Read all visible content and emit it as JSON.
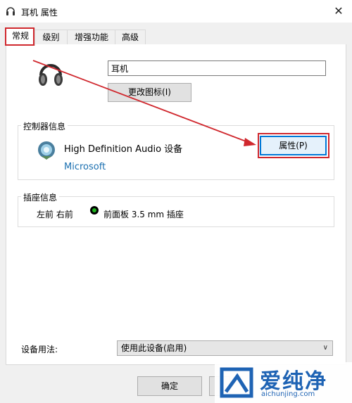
{
  "window": {
    "title": "耳机 属性",
    "close_glyph": "✕"
  },
  "tabs": [
    {
      "label": "常规",
      "active": true
    },
    {
      "label": "级别",
      "active": false
    },
    {
      "label": "增强功能",
      "active": false
    },
    {
      "label": "高级",
      "active": false
    }
  ],
  "general": {
    "device_name": "耳机",
    "change_icon_label": "更改图标(I)",
    "controller_group_label": "控制器信息",
    "controller_name": "High Definition Audio 设备",
    "controller_vendor": "Microsoft",
    "properties_label": "属性(P)",
    "jack_group_label": "插座信息",
    "jack_channels": "左前 右前",
    "jack_description": "前面板 3.5 mm 插座",
    "jack_color": "#1db31d",
    "device_usage_label": "设备用法:",
    "device_usage_value": "使用此设备(启用)"
  },
  "footer": {
    "ok_label": "确定"
  },
  "watermark": {
    "text": "爱纯净",
    "url": "aichunjing.com"
  },
  "colors": {
    "annotation_red": "#d0282e",
    "link_blue": "#1a6fb0",
    "focus_blue": "#0078d7"
  }
}
